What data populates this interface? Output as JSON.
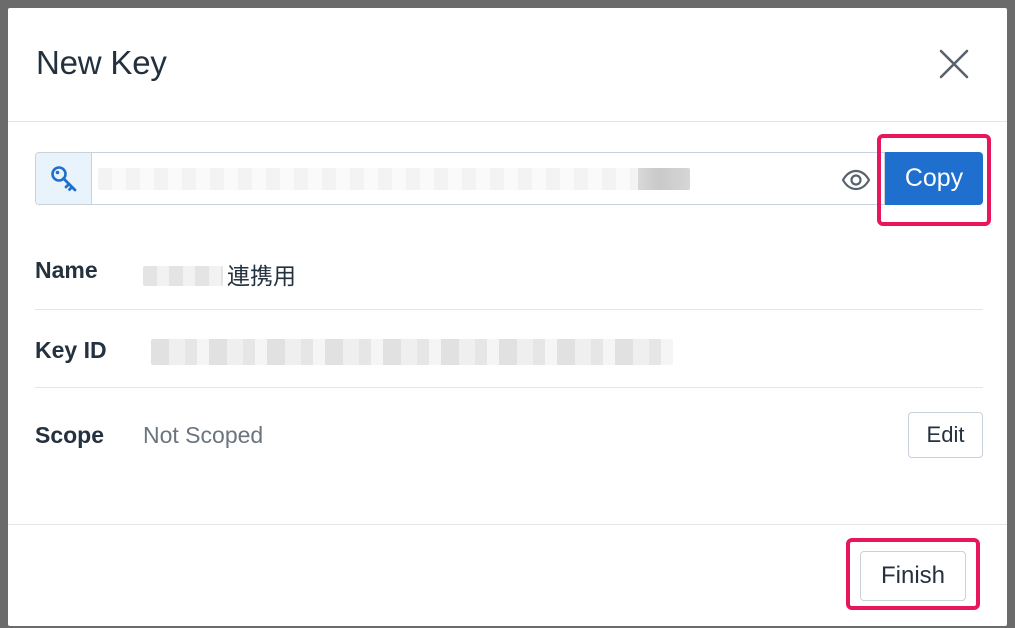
{
  "modal": {
    "title": "New Key",
    "close_icon": "close-icon"
  },
  "key": {
    "icon": "key-icon",
    "value": "",
    "reveal_icon": "eye-icon",
    "copy_label": "Copy"
  },
  "details": {
    "name_label": "Name",
    "name_value_suffix": "連携用",
    "key_id_label": "Key ID",
    "scope_label": "Scope",
    "scope_value": "Not Scoped",
    "edit_label": "Edit"
  },
  "footer": {
    "finish_label": "Finish"
  },
  "colors": {
    "primary": "#1f6fce",
    "highlight": "#e8175d",
    "key_icon_bg": "#e9f3fc"
  }
}
